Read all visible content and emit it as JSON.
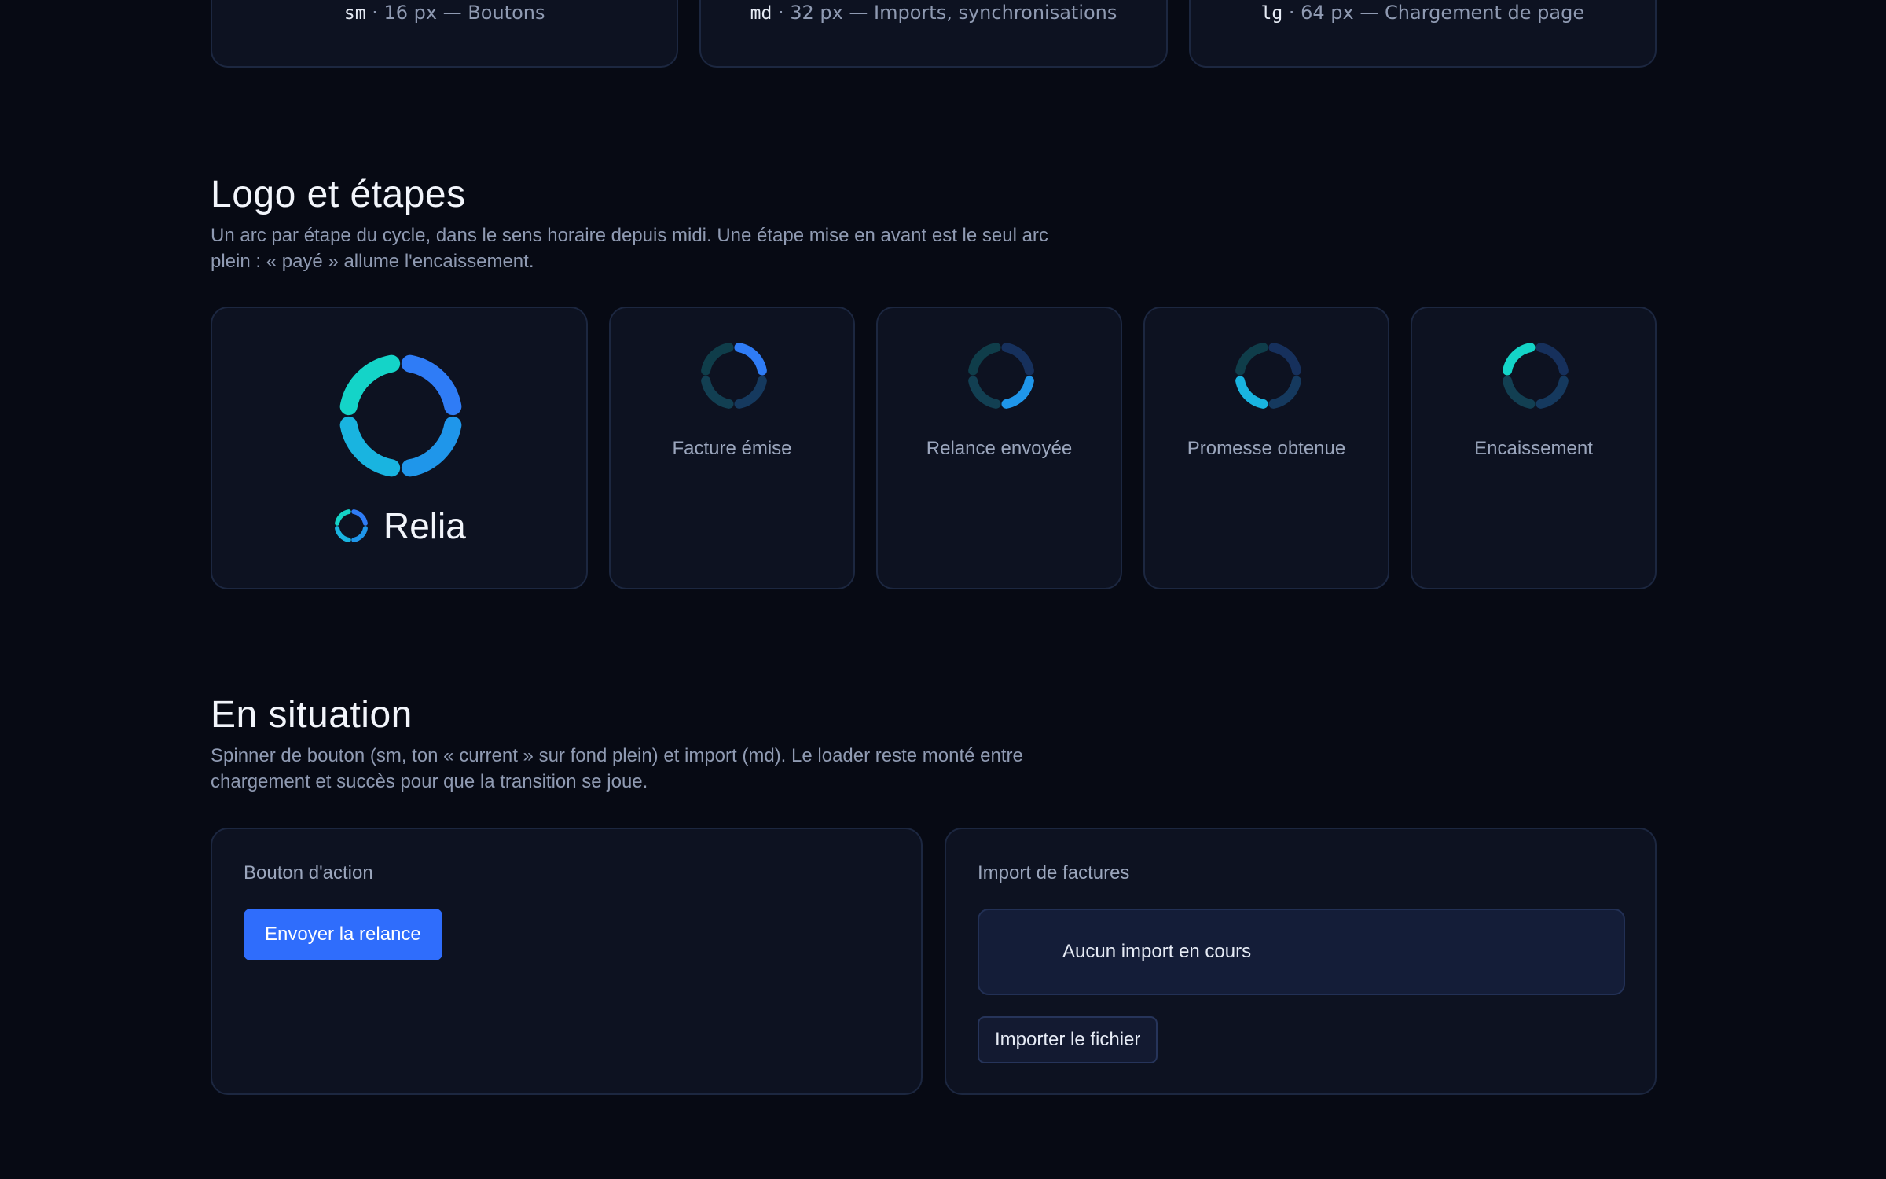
{
  "sizes": [
    {
      "code": "sm",
      "text": "· 16 px — Boutons"
    },
    {
      "code": "md",
      "text": "· 32 px — Imports, synchronisations"
    },
    {
      "code": "lg",
      "text": "· 64 px — Chargement de page"
    }
  ],
  "logo_section": {
    "title": "Logo et étapes",
    "description": "Un arc par étape du cycle, dans le sens horaire depuis midi. Une étape mise en avant est le seul arc plein : « payé » allume l'encaissement.",
    "brand_name": "Relia",
    "stages": [
      {
        "label": "Facture émise"
      },
      {
        "label": "Relance envoyée"
      },
      {
        "label": "Promesse obtenue"
      },
      {
        "label": "Encaissement"
      }
    ]
  },
  "situation_section": {
    "title": "En situation",
    "description": "Spinner de bouton (sm, ton « current » sur fond plein) et import (md). Le loader reste monté entre chargement et succès pour que la transition se joue.",
    "action_panel": {
      "title": "Bouton d'action",
      "button_label": "Envoyer la relance"
    },
    "import_panel": {
      "title": "Import de factures",
      "status": "Aucun import en cours",
      "button_label": "Importer le fichier"
    }
  },
  "colors": {
    "background": "#070a14",
    "card": "#0d1221",
    "primary": "#2f6dfc",
    "arc_teal": "#14d4c8",
    "arc_blue": "#2f6dfc"
  }
}
